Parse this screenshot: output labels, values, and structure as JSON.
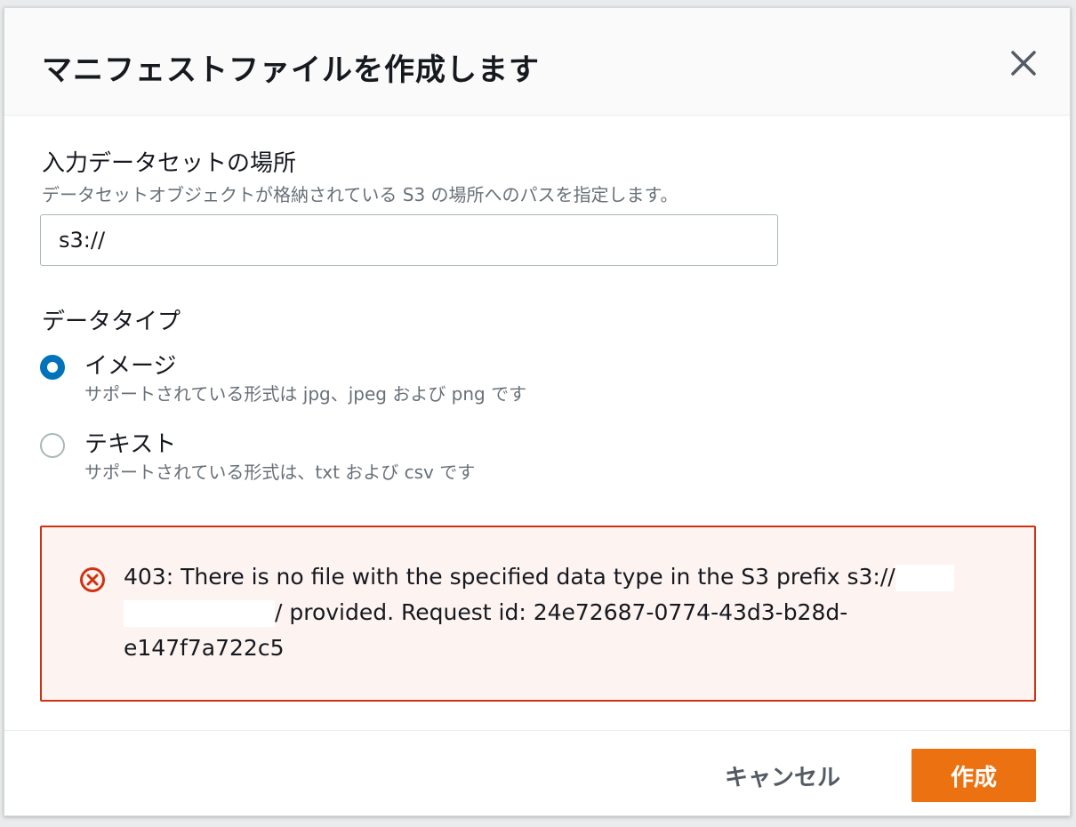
{
  "modal": {
    "title": "マニフェストファイルを作成します"
  },
  "location": {
    "label": "入力データセットの場所",
    "description": "データセットオブジェクトが格納されている S3 の場所へのパスを指定します。",
    "input_value": "s3://"
  },
  "data_type": {
    "label": "データタイプ",
    "options": [
      {
        "label": "イメージ",
        "description": "サポートされている形式は jpg、jpeg および png です",
        "selected": true
      },
      {
        "label": "テキスト",
        "description": "サポートされている形式は、txt および csv です",
        "selected": false
      }
    ]
  },
  "error": {
    "line1": "403: There is no file with the specified data type in the S3 prefix s3://",
    "line2": "/ provided. Request id: 24e72687-0774-43d3-b28d-",
    "line3": "e147f7a722c5"
  },
  "footer": {
    "cancel_label": "キャンセル",
    "create_label": "作成"
  },
  "colors": {
    "accent": "#ec7211",
    "radio_selected": "#0073bb",
    "error": "#d13212"
  }
}
